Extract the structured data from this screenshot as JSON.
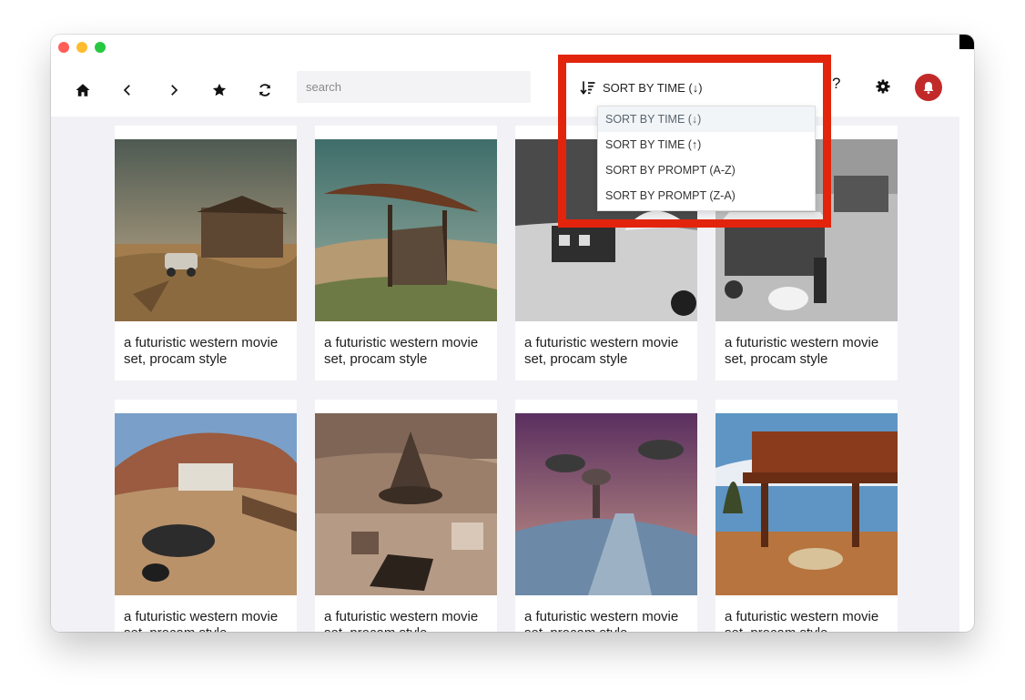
{
  "window": {
    "controls": [
      "close",
      "minimize",
      "maximize"
    ]
  },
  "toolbar": {
    "home_icon": "home-icon",
    "back_icon": "chevron-left-icon",
    "forward_icon": "chevron-right-icon",
    "favorites_icon": "star-icon",
    "refresh_icon": "refresh-icon",
    "search_placeholder": "search",
    "search_value": "",
    "sort_icon": "sort-descending-icon",
    "sort_label": "SORT BY TIME (↓)",
    "help_label": "?",
    "settings_icon": "gear-icon",
    "notifications_icon": "bell-icon",
    "accent": "#c22a2a"
  },
  "sort_menu": {
    "selected_index": 0,
    "options": [
      "SORT BY TIME (↓)",
      "SORT BY TIME (↑)",
      "SORT BY PROMPT (A-Z)",
      "SORT BY PROMPT (Z-A)"
    ]
  },
  "highlight": {
    "color": "#e3240c"
  },
  "gallery": {
    "cards": [
      {
        "caption": "a futuristic western movie set, procam style"
      },
      {
        "caption": "a futuristic western movie set, procam style"
      },
      {
        "caption": "a futuristic western movie set, procam style"
      },
      {
        "caption": "a futuristic western movie set, procam style"
      },
      {
        "caption": "a futuristic western movie set, procam style"
      },
      {
        "caption": "a futuristic western movie set, procam style"
      },
      {
        "caption": "a futuristic western movie set, procam style"
      },
      {
        "caption": "a futuristic western movie set, procam style"
      }
    ]
  }
}
